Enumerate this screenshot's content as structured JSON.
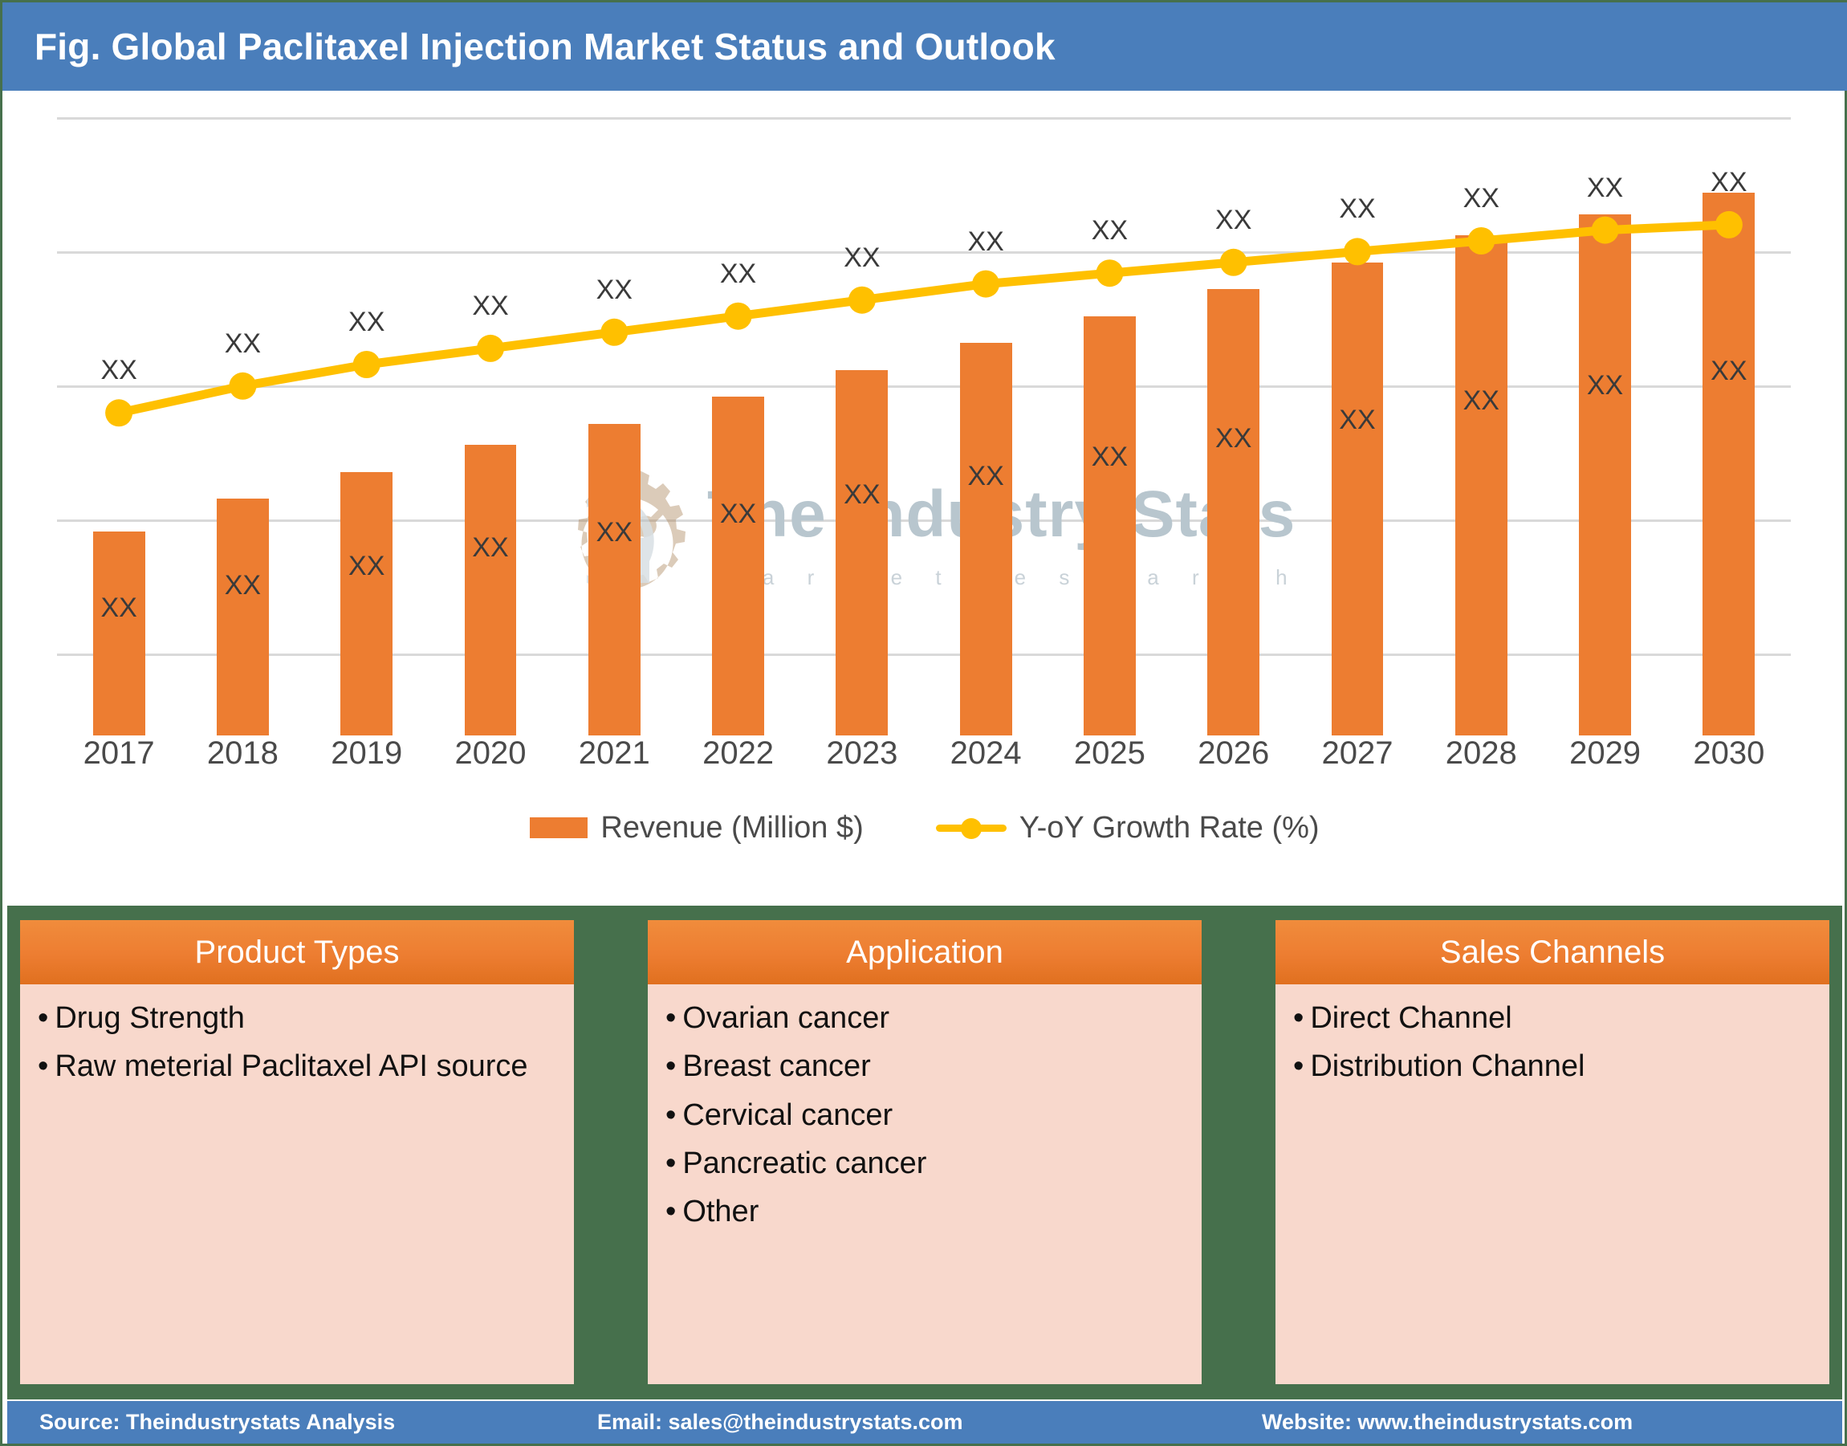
{
  "header": {
    "title": "Fig. Global Paclitaxel Injection Market Status and Outlook"
  },
  "colors": {
    "header_blue": "#4A7EBB",
    "bar_orange": "#ED7D31",
    "line_yellow": "#FFC000",
    "band_green": "#46704C",
    "panel_body_pink": "#F8D8CC",
    "gridline_gray": "#D9D9D9",
    "label_gray": "#3A3A3A"
  },
  "watermark": {
    "title": "The Industry Stats",
    "subtitle": "m a r k e t   r e s e a r c h"
  },
  "chart_data": {
    "type": "bar",
    "title": "Fig. Global Paclitaxel Injection Market Status and Outlook",
    "xlabel": "",
    "ylabel": "",
    "grid": true,
    "legend_position": "bottom",
    "categories": [
      "2017",
      "2018",
      "2019",
      "2020",
      "2021",
      "2022",
      "2023",
      "2024",
      "2025",
      "2026",
      "2027",
      "2028",
      "2029",
      "2030"
    ],
    "value_label": "XX",
    "bar_labels_inside": [
      "XX",
      "XX",
      "XX",
      "XX",
      "XX",
      "XX",
      "XX",
      "XX",
      "XX",
      "XX",
      "XX",
      "XX",
      "XX",
      "XX"
    ],
    "line_labels_above": [
      "XX",
      "XX",
      "XX",
      "XX",
      "XX",
      "XX",
      "XX",
      "XX",
      "XX",
      "XX",
      "XX",
      "XX",
      "XX",
      "XX"
    ],
    "series": [
      {
        "name": "Revenue (Million $)",
        "type": "bar",
        "color": "#ED7D31",
        "values": [
          38,
          44,
          49,
          54,
          58,
          63,
          68,
          73,
          78,
          83,
          88,
          93,
          97,
          101
        ]
      },
      {
        "name": "Y-oY Growth Rate (%)",
        "type": "line",
        "color": "#FFC000",
        "marker": "circle",
        "values": [
          60,
          65,
          69,
          72,
          75,
          78,
          81,
          84,
          86,
          88,
          90,
          92,
          94,
          95
        ]
      }
    ],
    "ylim": [
      0,
      115
    ],
    "gridline_values": [
      0,
      25,
      50,
      75,
      100
    ]
  },
  "legend": {
    "items": [
      {
        "label": "Revenue (Million $)",
        "marker": "square",
        "color": "#ED7D31"
      },
      {
        "label": "Y-oY Growth Rate (%)",
        "marker": "line-dot",
        "color": "#FFC000"
      }
    ]
  },
  "panels": [
    {
      "title": "Product Types",
      "items": [
        "Drug Strength",
        "Raw meterial Paclitaxel API source"
      ]
    },
    {
      "title": "Application",
      "items": [
        "Ovarian cancer",
        "Breast cancer",
        "Cervical cancer",
        "Pancreatic cancer",
        "Other"
      ]
    },
    {
      "title": "Sales Channels",
      "items": [
        "Direct Channel",
        "Distribution Channel"
      ]
    }
  ],
  "footer": {
    "source": "Source: Theindustrystats Analysis",
    "email": "Email: sales@theindustrystats.com",
    "website": "Website: www.theindustrystats.com"
  }
}
